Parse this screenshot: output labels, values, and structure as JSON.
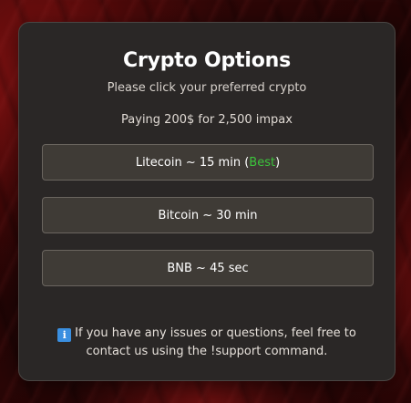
{
  "dialog": {
    "title": "Crypto Options",
    "subtitle": "Please click your preferred crypto",
    "price_text": "Paying 200$ for 2,500 impax"
  },
  "options": [
    {
      "label": "Litecoin ~ 15 min (",
      "highlight": "Best",
      "suffix": ")"
    },
    {
      "label": "Bitcoin ~ 30 min"
    },
    {
      "label": "BNB ~ 45 sec"
    }
  ],
  "notice": {
    "icon": "info-icon",
    "icon_glyph": "i",
    "text": "If you have any issues or questions, feel free to contact us using the !support command."
  },
  "colors": {
    "card_bg": "#2a2726",
    "button_bg": "#3f3b36",
    "best_accent": "#3cc43c",
    "info_icon": "#3a8fe0"
  }
}
